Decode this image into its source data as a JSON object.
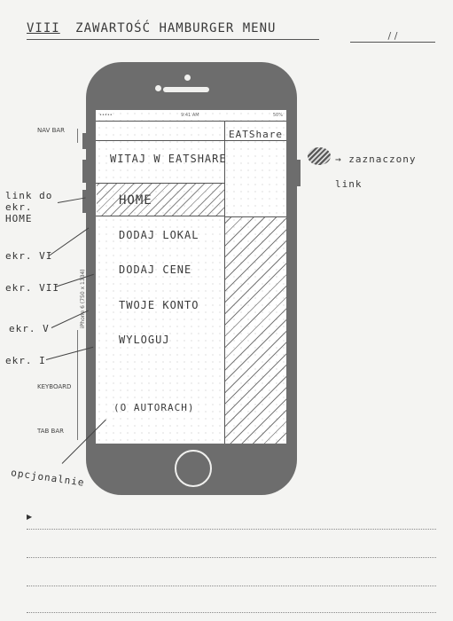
{
  "header": {
    "roman": "VIII",
    "title": "ZAWARTOŚĆ HAMBURGER MENU",
    "date": "/ /"
  },
  "phone": {
    "status": {
      "signal": "•••••",
      "time": "9:41 AM",
      "battery": "50%"
    },
    "right_panel_title": "EATShare",
    "menu": {
      "welcome": "WITAJ W EATSHARE",
      "items": [
        "HOME",
        "DODAJ LOKAL",
        "DODAJ CENE",
        "TWOJE KONTO",
        "WYLOGUJ"
      ],
      "optional": "(O AUTORACH)"
    },
    "vertical_label": "iPhone 6 (750 x 1334)"
  },
  "left_labels": {
    "nav_bar": "NAV BAR",
    "keyboard": "KEYBOARD",
    "tab_bar": "TAB BAR"
  },
  "annotations": {
    "link_home": "link do ekr. HOME",
    "ekr_vi": "ekr. VI",
    "ekr_vii": "ekr. VII",
    "ekr_v": "ekr. V",
    "ekr_i": "ekr. I",
    "optional": "opcjonalnie"
  },
  "legend": {
    "text": "→ zaznaczony link"
  },
  "notes": {
    "bullet": "▶"
  }
}
